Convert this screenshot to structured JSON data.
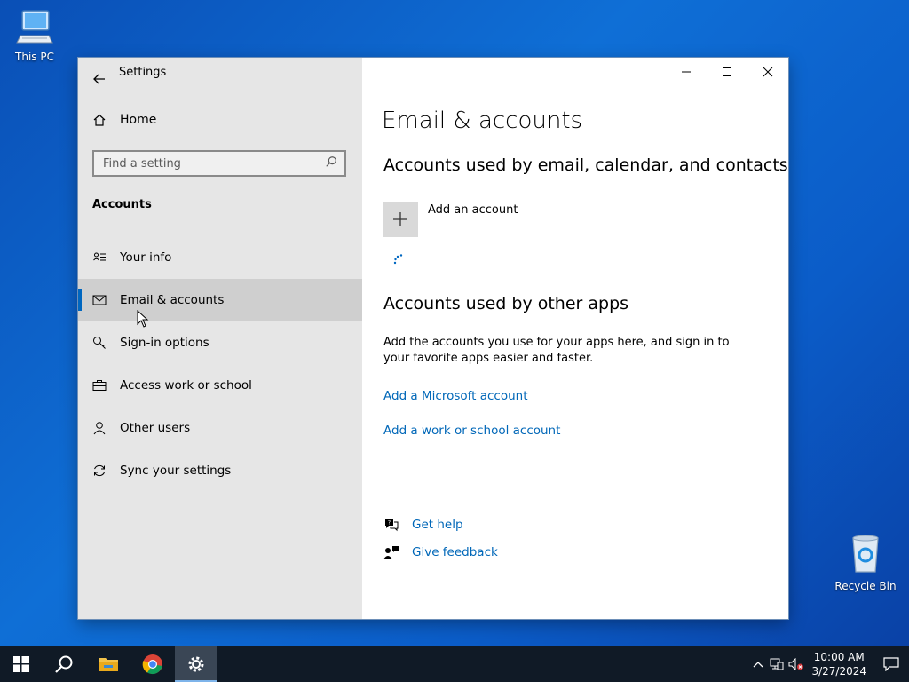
{
  "desktop": {
    "icons": [
      {
        "label": "This PC"
      },
      {
        "label": "Recycle Bin"
      }
    ]
  },
  "window": {
    "title": "Settings",
    "sidebar": {
      "home_label": "Home",
      "search_placeholder": "Find a setting",
      "section_label": "Accounts",
      "items": [
        {
          "label": "Your info",
          "icon": "contact-card-icon"
        },
        {
          "label": "Email & accounts",
          "icon": "mail-icon",
          "selected": true
        },
        {
          "label": "Sign-in options",
          "icon": "key-icon"
        },
        {
          "label": "Access work or school",
          "icon": "briefcase-icon"
        },
        {
          "label": "Other users",
          "icon": "person-icon"
        },
        {
          "label": "Sync your settings",
          "icon": "sync-icon"
        }
      ]
    },
    "main": {
      "page_title": "Email & accounts",
      "section1_title": "Accounts used by email, calendar, and contacts",
      "add_account_label": "Add an account",
      "section2_title": "Accounts used by other apps",
      "section2_desc": "Add the accounts you use for your apps here, and sign in to your favorite apps easier and faster.",
      "link_microsoft": "Add a Microsoft account",
      "link_work": "Add a work or school account",
      "get_help": "Get help",
      "give_feedback": "Give feedback"
    }
  },
  "taskbar": {
    "time": "10:00 AM",
    "date": "3/27/2024"
  },
  "colors": {
    "accent": "#0067c0",
    "link": "#0067b8",
    "sidebar_bg": "#e6e6e6",
    "selected_bg": "#cfcfcf",
    "taskbar_bg": "#101a26"
  }
}
